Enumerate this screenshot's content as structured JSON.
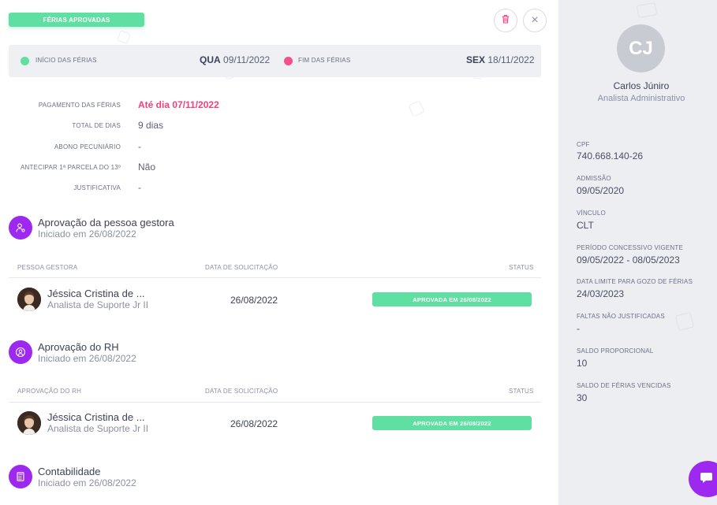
{
  "status_badge": "FÉRIAS APROVADAS",
  "header_actions": {
    "delete_icon": "trash-icon",
    "close_icon": "close-icon",
    "close_glyph": "×"
  },
  "dates": {
    "start_label": "INÍCIO DAS FÉRIAS",
    "start_weekday": "QUA",
    "start_date": "09/11/2022",
    "end_label": "FIM DAS FÉRIAS",
    "end_weekday": "SEX",
    "end_date": "18/11/2022"
  },
  "info": [
    {
      "label": "PAGAMENTO DAS FÉRIAS",
      "value": "Até dia 07/11/2022"
    },
    {
      "label": "TOTAL DE DIAS",
      "value": "9 dias"
    },
    {
      "label": "ABONO PECUNIÁRIO",
      "value": "-"
    },
    {
      "label": "ANTECIPAR 1ª PARCELA DO 13º",
      "value": "Não"
    },
    {
      "label": "JUSTIFICATIVA",
      "value": "-"
    }
  ],
  "steps": [
    {
      "title": "Aprovação da pessoa gestora",
      "subtitle": "Iniciado em 26/08/2022",
      "col_person": "PESSOA GESTORA",
      "col_date": "DATA DE SOLICITAÇÃO",
      "col_status": "STATUS",
      "row": {
        "name": "Jéssica Cristina de ...",
        "role": "Analista de Suporte Jr II",
        "date": "26/08/2022",
        "status": "APROVADA EM 26/08/2022"
      }
    },
    {
      "title": "Aprovação do RH",
      "subtitle": "Iniciado em 26/08/2022",
      "col_person": "APROVAÇÃO DO RH",
      "col_date": "DATA DE SOLICITAÇÃO",
      "col_status": "STATUS",
      "row": {
        "name": "Jéssica Cristina de ...",
        "role": "Analista de Suporte Jr II",
        "date": "26/08/2022",
        "status": "APROVADA EM 26/08/2022"
      }
    },
    {
      "title": "Contabilidade",
      "subtitle": "Iniciado em 26/08/2022"
    }
  ],
  "employee": {
    "initials": "CJ",
    "name": "Carlos Júniro",
    "role": "Analista Administrativo",
    "fields": [
      {
        "label": "CPF",
        "value": "740.668.140-26"
      },
      {
        "label": "ADMISSÃO",
        "value": "09/05/2020"
      },
      {
        "label": "VÍNCULO",
        "value": "CLT"
      },
      {
        "label": "PERÍODO CONCESSIVO VIGENTE",
        "value": "09/05/2022 - 08/05/2023"
      },
      {
        "label": "DATA LIMITE PARA GOZO DE FÉRIAS",
        "value": "24/03/2023"
      },
      {
        "label": "FALTAS NÃO JUSTIFICADAS",
        "value": "-"
      },
      {
        "label": "SALDO PROPORCIONAL",
        "value": "10"
      },
      {
        "label": "SALDO DE FÉRIAS VENCIDAS",
        "value": "30"
      }
    ]
  },
  "colors": {
    "accent": "#9d28f0",
    "success": "#5fe0a2",
    "danger": "#f0407e"
  }
}
